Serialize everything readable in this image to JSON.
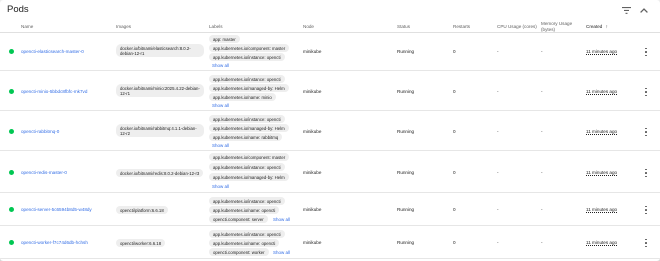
{
  "card": {
    "title": "Pods"
  },
  "columns": {
    "name": "Name",
    "images": "Images",
    "labels": "Labels",
    "node": "Node",
    "status": "Status",
    "restarts": "Restarts",
    "cpu": "CPU Usage (cores)",
    "memory": "Memory Usage (bytes)",
    "created": "Created",
    "created_sort": "↑"
  },
  "rows": [
    {
      "name": "opencti-elasticsearch-master-0",
      "image": "docker.io/bitnami/elasticsearch:8.0.2-debian-12-r1",
      "labels": [
        "app: master",
        "app.kubernetes.io/component: master",
        "app.kubernetes.io/instance: opencti"
      ],
      "show_all": "Show all",
      "node": "minikube",
      "status": "Running",
      "restarts": "0",
      "cpu": "-",
      "memory": "-",
      "created": "11 minutes ago"
    },
    {
      "name": "opencti-minio-5bbdc8fbfc-mk7vd",
      "image": "docker.io/bitnami/minio:2025.4.22-debian-12-r1",
      "labels": [
        "app.kubernetes.io/instance: opencti",
        "app.kubernetes.io/managed-by: Helm",
        "app.kubernetes.io/name: minio"
      ],
      "show_all": "Show all",
      "node": "minikube",
      "status": "Running",
      "restarts": "0",
      "cpu": "-",
      "memory": "-",
      "created": "11 minutes ago"
    },
    {
      "name": "opencti-rabbitmq-0",
      "image": "docker.io/bitnami/rabbitmq:4.1.1-debian-12-r2",
      "labels": [
        "app.kubernetes.io/instance: opencti",
        "app.kubernetes.io/managed-by: Helm",
        "app.kubernetes.io/name: rabbitmq"
      ],
      "show_all": "Show all",
      "node": "minikube",
      "status": "Running",
      "restarts": "0",
      "cpu": "-",
      "memory": "-",
      "created": "11 minutes ago"
    },
    {
      "name": "opencti-redis-master-0",
      "image": "docker.io/bitnami/redis:8.0.2-debian-12-r3",
      "labels": [
        "app.kubernetes.io/component: master",
        "app.kubernetes.io/instance: opencti",
        "app.kubernetes.io/managed-by: Helm"
      ],
      "show_all": "Show all",
      "node": "minikube",
      "status": "Running",
      "restarts": "0",
      "cpu": "-",
      "memory": "-",
      "created": "11 minutes ago"
    },
    {
      "name": "opencti-server-5c6594b8d5-w48dy",
      "image": "opencti/platform:6.6.18",
      "labels": [
        "app.kubernetes.io/instance: opencti",
        "app.kubernetes.io/name: opencti",
        "opencti.component: server"
      ],
      "show_all": "Show all",
      "node": "minikube",
      "status": "Running",
      "restarts": "0",
      "cpu": "-",
      "memory": "-",
      "created": "11 minutes ago"
    },
    {
      "name": "opencti-worker-f7c74d6db-hchsh",
      "image": "opencti/worker:6.6.18",
      "labels": [
        "app.kubernetes.io/instance: opencti",
        "app.kubernetes.io/name: opencti",
        "opencti.component: worker"
      ],
      "show_all": "Show all",
      "node": "minikube",
      "status": "Running",
      "restarts": "0",
      "cpu": "-",
      "memory": "-",
      "created": "11 minutes ago"
    }
  ],
  "icons": {
    "filter": "filter-icon",
    "collapse": "chevron-up-icon",
    "row_menu": "more-vert-icon",
    "status": "status-dot"
  },
  "colors": {
    "running": "#00c752",
    "link": "#326de6"
  }
}
